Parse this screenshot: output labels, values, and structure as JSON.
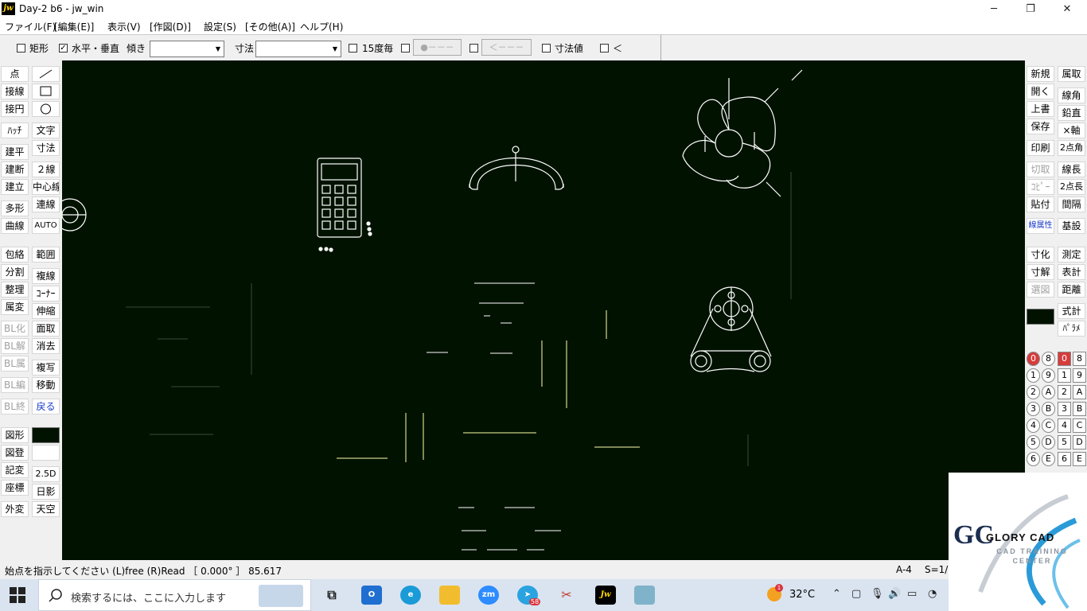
{
  "window": {
    "title": "Day-2 b6 - jw_win",
    "app_icon": "jw",
    "minimize": "─",
    "restore": "❐",
    "close": "✕"
  },
  "menu": [
    "ファイル(F)",
    "[編集(E)]",
    "表示(V)",
    "[作図(D)]",
    "設定(S)",
    "[その他(A)]",
    "ヘルプ(H)"
  ],
  "toolbar": {
    "rect_label": "矩形",
    "rect_checked": false,
    "hv_label": "水平・垂直",
    "hv_checked": true,
    "tilt_label": "傾き",
    "tilt_value": "",
    "dim_label": "寸法",
    "dim_value": "",
    "deg15_label": "15度毎",
    "btn_point": "●－－－",
    "btn_arrow": "＜－－－",
    "dimval_label": "寸法値",
    "lt_label": "＜",
    "combo_arrow": "▼"
  },
  "left_tools": [
    [
      "点",
      "line-tool"
    ],
    [
      "接線",
      "rect-tool"
    ],
    [
      "接円",
      "circle-tool"
    ],
    [
      "ﾊｯﾁ",
      "文字"
    ],
    [
      "建平",
      "寸法"
    ],
    [
      "建断",
      "２線"
    ],
    [
      "建立",
      "中心線"
    ],
    [
      "多形",
      "連線"
    ],
    [
      "曲線",
      "AUTO"
    ],
    [
      "包絡",
      "範囲"
    ],
    [
      "分割",
      "複線"
    ],
    [
      "整理",
      "ｺｰﾅｰ"
    ],
    [
      "属変",
      "伸縮"
    ],
    [
      "BL化",
      "面取"
    ],
    [
      "BL解",
      "消去"
    ],
    [
      "BL属",
      "複写"
    ],
    [
      "BL編",
      "移動"
    ],
    [
      "BL終",
      "戻る"
    ],
    [
      "図形",
      "color-swatch"
    ],
    [
      "図登",
      ""
    ],
    [
      "記変",
      "2.5D"
    ],
    [
      "座標",
      "日影"
    ],
    [
      "外変",
      "天空"
    ]
  ],
  "right_tools": [
    [
      "新規",
      "属取"
    ],
    [
      "開く",
      "線角"
    ],
    [
      "上書",
      "鉛直"
    ],
    [
      "保存",
      "×軸"
    ],
    [
      "印刷",
      "2点角"
    ],
    [
      "切取",
      "線長"
    ],
    [
      "ｺﾋﾟｰ",
      "2点長"
    ],
    [
      "貼付",
      "間隔"
    ],
    [
      "線属性",
      "基設"
    ],
    [
      "寸化",
      "測定"
    ],
    [
      "寸解",
      "表計"
    ],
    [
      "選図",
      "距離"
    ],
    [
      "color-swatch",
      "式計"
    ],
    [
      "",
      "ﾊﾟﾗﾒ"
    ]
  ],
  "layers_a": [
    "0",
    "1",
    "2",
    "3",
    "4",
    "5",
    "6"
  ],
  "layers_b": [
    "8",
    "9",
    "A",
    "B",
    "C",
    "D",
    "E"
  ],
  "layers_c": [
    "0",
    "1",
    "2",
    "3",
    "4",
    "5",
    "6"
  ],
  "layers_d": [
    "8",
    "9",
    "A",
    "B",
    "C",
    "D",
    "E"
  ],
  "status": {
    "message": "始点を指示してください (L)free (R)Read ［ 0.000° ］ 85.617",
    "paper": "A-4",
    "scale": "S=1/"
  },
  "logo": {
    "main": "GLORY CAD",
    "sub": "CAD TRAINING CENTER",
    "mark": "GC"
  },
  "taskbar": {
    "search_placeholder": "検索するには、ここに入力します",
    "temperature": "32°C",
    "telegram_badge": "58",
    "weather_badge": "1",
    "zoom_label": "zm",
    "jw_label": "Jw"
  },
  "colors": {
    "canvas_bg": "#011200",
    "drawing_line": "#ffffff",
    "accent_line": "#ffffaa",
    "selected_layer": "#d63c3c"
  }
}
